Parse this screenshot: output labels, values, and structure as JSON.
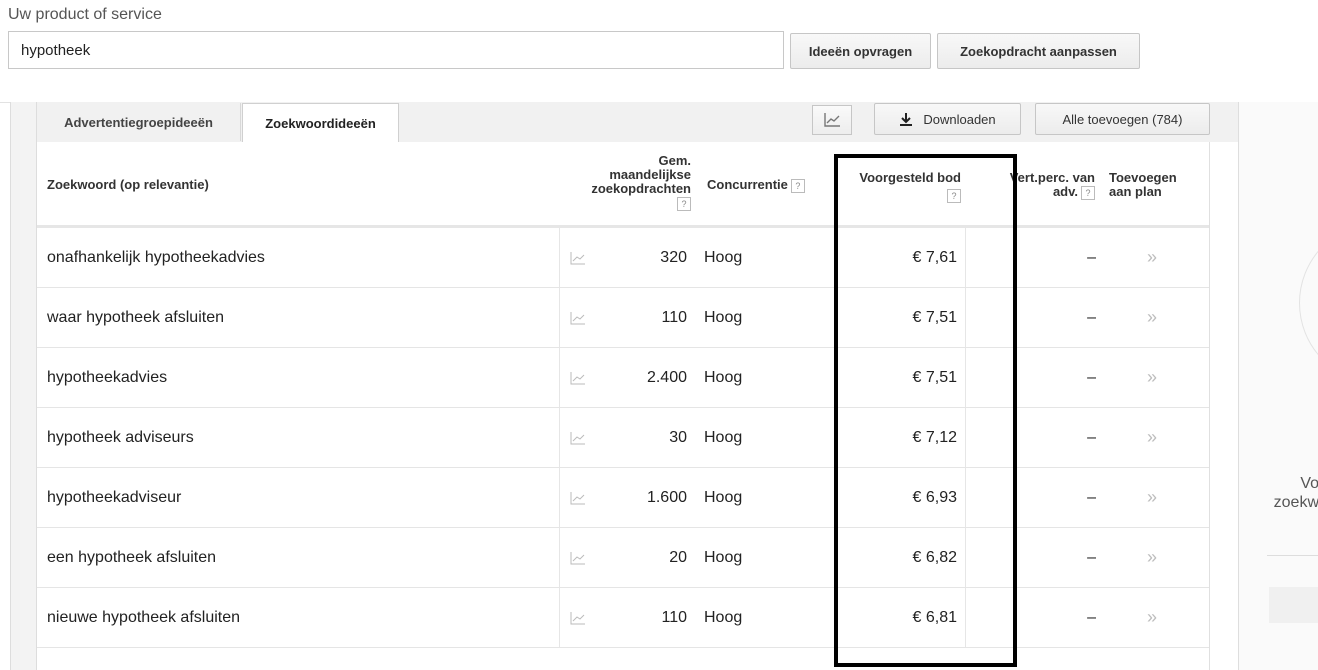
{
  "form": {
    "label": "Uw product of service",
    "search_value": "hypotheek",
    "get_ideas": "Ideeën opvragen",
    "modify_search": "Zoekopdracht aanpassen"
  },
  "tabs": [
    {
      "label": "Advertentiegroepideeën"
    },
    {
      "label": "Zoekwoordideeën"
    }
  ],
  "toolbar": {
    "chart_icon": "chart-line-icon",
    "download": "Downloaden",
    "add_all": "Alle toevoegen (784)"
  },
  "headers": {
    "keyword": "Zoekwoord (op relevantie)",
    "volume": [
      "Gem.",
      "maandelijkse",
      "zoekopdrachten"
    ],
    "competition": "Concurrentie",
    "bid": "Voorgesteld bod",
    "share": [
      "Vert.perc. van",
      "adv."
    ],
    "add": [
      "Toevoegen",
      "aan plan"
    ],
    "help": "?"
  },
  "rows": [
    {
      "keyword": "onafhankelijk hypotheekadvies",
      "volume": "320",
      "competition": "Hoog",
      "bid": "€ 7,61",
      "share": "–",
      "add": "»"
    },
    {
      "keyword": "waar hypotheek afsluiten",
      "volume": "110",
      "competition": "Hoog",
      "bid": "€ 7,51",
      "share": "–",
      "add": "»"
    },
    {
      "keyword": "hypotheekadvies",
      "volume": "2.400",
      "competition": "Hoog",
      "bid": "€ 7,51",
      "share": "–",
      "add": "»"
    },
    {
      "keyword": "hypotheek adviseurs",
      "volume": "30",
      "competition": "Hoog",
      "bid": "€ 7,12",
      "share": "–",
      "add": "»"
    },
    {
      "keyword": "hypotheekadviseur",
      "volume": "1.600",
      "competition": "Hoog",
      "bid": "€ 6,93",
      "share": "–",
      "add": "»"
    },
    {
      "keyword": "een hypotheek afsluiten",
      "volume": "20",
      "competition": "Hoog",
      "bid": "€ 6,82",
      "share": "–",
      "add": "»"
    },
    {
      "keyword": "nieuwe hypotheek afsluiten",
      "volume": "110",
      "competition": "Hoog",
      "bid": "€ 6,81",
      "share": "–",
      "add": "»"
    }
  ],
  "side_panel": {
    "line1": "Vo",
    "line2": "zoekw"
  }
}
